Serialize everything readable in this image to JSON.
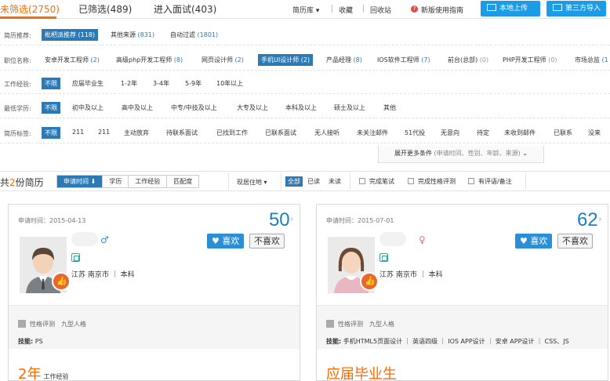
{
  "tabs": [
    {
      "label": "未筛选(2750)",
      "active": true
    },
    {
      "label": "已筛选(489)",
      "active": false
    },
    {
      "label": "进入面试(403)",
      "active": false
    }
  ],
  "top_links": {
    "library": "简历库 ▾",
    "favorites": "收藏",
    "trash": "回收站",
    "guide": "新版使用指南",
    "upload": "本地上传",
    "import": "第三方导入"
  },
  "colors": {
    "accent": "#ff6a00",
    "primary": "#2a7ab8",
    "button": "#1c9be6"
  },
  "filters": {
    "recommend": {
      "label": "简历推荐:",
      "items": [
        {
          "name": "枇杷派推荐",
          "count": "(118)",
          "selected": true
        },
        {
          "name": "其他来源",
          "count": "(831)",
          "selected": false
        },
        {
          "name": "自动过滤",
          "count": "(1801)",
          "selected": false
        }
      ]
    },
    "position": {
      "label": "职位名称:",
      "items": [
        {
          "name": "安卓开发工程师",
          "count": "(2)"
        },
        {
          "name": "高级php开发工程师",
          "count": "(8)"
        },
        {
          "name": "网页设计师",
          "count": "(2)"
        },
        {
          "name": "手机UI设计师",
          "count": "(2)",
          "selected": true
        },
        {
          "name": "产品经理",
          "count": "(8)"
        },
        {
          "name": "IOS软件工程师",
          "count": "(7)"
        },
        {
          "name": "前台(总部)",
          "count": "(0)"
        },
        {
          "name": "PHP开发工程师",
          "count": "(0)"
        },
        {
          "name": "市场总监",
          "count": "(1"
        }
      ]
    },
    "experience": {
      "label": "工作经验:",
      "items": [
        "不限",
        "应届毕业生",
        "1-2年",
        "3-4年",
        "5-9年",
        "10年以上"
      ]
    },
    "education": {
      "label": "最低学历:",
      "items": [
        "不限",
        "初中及以上",
        "高中及以上",
        "中专/中技及以上",
        "大专及以上",
        "本科及以上",
        "硕士及以上",
        "其他"
      ]
    },
    "tags": {
      "label": "简历标签:",
      "items": [
        "不限",
        "211",
        "211",
        "主动放弃",
        "待联系面试",
        "已找到工作",
        "已联系面试",
        "无人接听",
        "未关注邮件",
        "51代投",
        "无意向",
        "待定",
        "未收到邮件",
        "已联系",
        "没来"
      ]
    },
    "expand": {
      "main": "展开更多条件",
      "hint": "(申请时间、性别、年龄、来源)",
      "arrow": "⌄"
    }
  },
  "toolbar": {
    "total_prefix": "共",
    "total_num": "2",
    "total_suffix": "份简历",
    "sort": [
      "申请时间 ⬇",
      "学历",
      "工作经验",
      "匹配度"
    ],
    "location": "现居住地 ▾",
    "read_filters": [
      "全部",
      "已读",
      "未读"
    ],
    "checks": [
      "完成笔试",
      "完成性格评测",
      "有评语/备注"
    ]
  },
  "cards": [
    {
      "date": "申请时间：2015-04-13",
      "score": "50",
      "like": "♥ 喜欢",
      "dislike": "不喜欢",
      "gender": "♂",
      "location": "江苏 南京市 ｜ 本科",
      "personality": "性格评测　九型人格",
      "skills_label": "技能:",
      "skills": "PS",
      "exp_main": "2年",
      "exp_sub": "工作经验"
    },
    {
      "date": "申请时间：2015-07-01",
      "score": "62",
      "like": "♥ 喜欢",
      "dislike": "不喜欢",
      "gender": "♀",
      "location": "江苏 南京市 ｜ 本科",
      "personality": "性格评测　九型人格",
      "skills_label": "技能:",
      "skills": "手机HTML5页面设计 ｜ 英语四级 ｜ IOS APP设计 ｜ 安卓 APP设计 ｜ CSS、JS",
      "exp_main": "应届毕业生",
      "exp_sub": ""
    }
  ]
}
